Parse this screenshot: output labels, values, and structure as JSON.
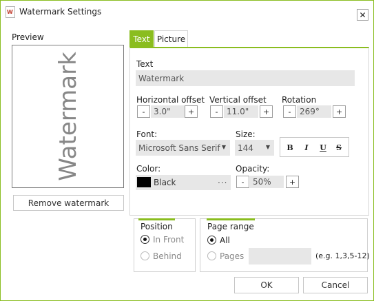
{
  "window": {
    "title": "Watermark Settings",
    "close_glyph": "✕"
  },
  "preview": {
    "label": "Preview",
    "watermark_text": "Watermark",
    "remove_button": "Remove watermark"
  },
  "tabs": [
    {
      "label": "Text",
      "active": true
    },
    {
      "label": "Picture",
      "active": false
    }
  ],
  "text_tab": {
    "text_label": "Text",
    "text_value": "Watermark",
    "horizontal_offset": {
      "label": "Horizontal offset",
      "value": "3.0\""
    },
    "vertical_offset": {
      "label": "Vertical offset",
      "value": "11.0\""
    },
    "rotation": {
      "label": "Rotation",
      "value": "269°"
    },
    "stepper": {
      "minus": "-",
      "plus": "+"
    },
    "font": {
      "label": "Font:",
      "value": "Microsoft Sans Serif"
    },
    "size": {
      "label": "Size:",
      "value": "144"
    },
    "format": {
      "bold": "B",
      "italic": "I",
      "underline": "U",
      "strike": "S"
    },
    "color": {
      "label": "Color:",
      "value": "Black",
      "swatch": "#000000",
      "more": "..."
    },
    "opacity": {
      "label": "Opacity:",
      "value": "50%"
    }
  },
  "position": {
    "label": "Position",
    "options": [
      "In Front",
      "Behind"
    ],
    "selected": "In Front"
  },
  "page_range": {
    "label": "Page range",
    "options": [
      "All",
      "Pages"
    ],
    "selected": "All",
    "hint": "(e.g. 1,3,5-12)"
  },
  "buttons": {
    "ok": "OK",
    "cancel": "Cancel"
  },
  "colors": {
    "accent": "#8abd1f",
    "field_bg": "#e7e7e7"
  }
}
